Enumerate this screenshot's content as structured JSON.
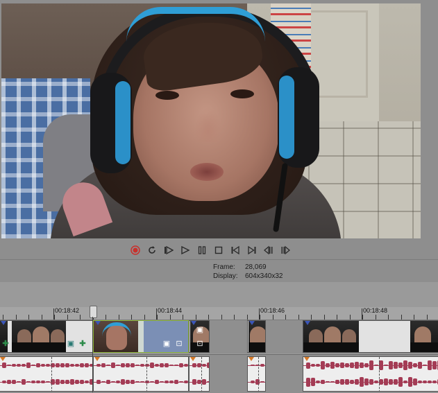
{
  "transport": {
    "buttons": [
      "record",
      "loop",
      "play-from-start",
      "play",
      "pause",
      "stop",
      "go-to-start",
      "go-to-end",
      "previous-frame",
      "next-frame"
    ],
    "record_color": "#c9302c"
  },
  "info": {
    "frame_label": "Frame:",
    "frame_value": "28,069",
    "display_label": "Display:",
    "display_value": "604x340x32"
  },
  "ruler": {
    "labels": [
      "00:18:42",
      "00:18:44",
      "00:18:46",
      "00:18:48"
    ]
  },
  "colors": {
    "audio_wave": "#a43c55",
    "selected_clip": "#7b8fb5",
    "fade_marker": "#d57a2a"
  }
}
